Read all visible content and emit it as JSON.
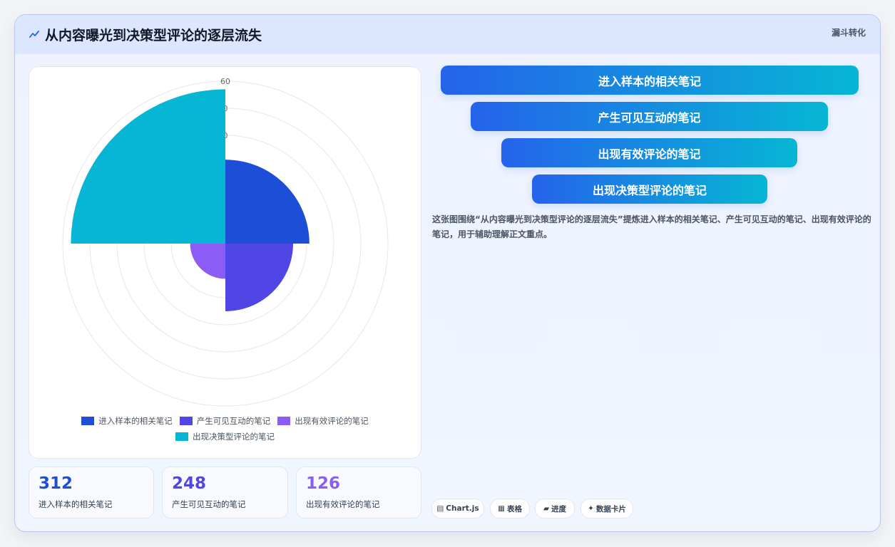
{
  "header": {
    "icon": "trend-line-icon",
    "title": "从内容曝光到决策型评论的逐层流失",
    "tag": "漏斗转化"
  },
  "chart_data": {
    "type": "polarArea",
    "categories": [
      "进入样本的相关笔记",
      "产生可见互动的笔记",
      "出现有效评论的笔记",
      "出现决策型评论的笔记"
    ],
    "values": [
      31,
      25,
      13,
      57
    ],
    "colors": [
      "#1d4ed8",
      "#4f46e5",
      "#8b5cf6",
      "#06b6d4"
    ],
    "radial_max": 60,
    "radial_step": 10,
    "tick_labels": [
      "60",
      "0",
      "0",
      "0"
    ],
    "legend_position": "bottom"
  },
  "stats": [
    {
      "value": "312",
      "label": "进入样本的相关笔记",
      "color": "#1d4ed8"
    },
    {
      "value": "248",
      "label": "产生可见互动的笔记",
      "color": "#4f46e5"
    },
    {
      "value": "126",
      "label": "出现有效评论的笔记",
      "color": "#8b5cf6"
    }
  ],
  "funnel": [
    "进入样本的相关笔记",
    "产生可见互动的笔记",
    "出现有效评论的笔记",
    "出现决策型评论的笔记"
  ],
  "description": "这张图围绕“从内容曝光到决策型评论的逐层流失”提炼进入样本的相关笔记、产生可见互动的笔记、出现有效评论的笔记，用于辅助理解正文重点。",
  "pills": [
    {
      "glyph": "▤",
      "label": "Chart.js",
      "icon": "chart-icon"
    },
    {
      "glyph": "▦",
      "label": "表格",
      "icon": "table-icon"
    },
    {
      "glyph": "▰",
      "label": "进度",
      "icon": "progress-icon"
    },
    {
      "glyph": "✦",
      "label": "数据卡片",
      "icon": "sparkle-icon"
    }
  ]
}
